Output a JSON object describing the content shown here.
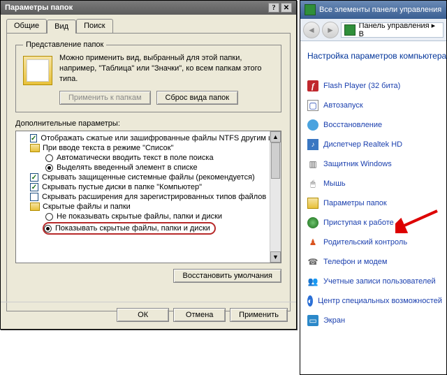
{
  "dialog": {
    "title": "Параметры папок",
    "tabs": {
      "general": "Общие",
      "view": "Вид",
      "search": "Поиск"
    },
    "group": {
      "legend": "Представление папок",
      "desc": "Можно применить вид, выбранный для этой папки, например, \"Таблица\" или \"Значки\", ко всем папкам этого типа.",
      "apply_btn": "Применить к папкам",
      "reset_btn": "Сброс вида папок"
    },
    "advanced_label": "Дополнительные параметры:",
    "tree": [
      {
        "type": "check",
        "checked": true,
        "indent": 1,
        "label": "Отображать сжатые или зашифрованные файлы NTFS другим цветом"
      },
      {
        "type": "folder",
        "indent": 1,
        "label": "При вводе текста в режиме \"Список\""
      },
      {
        "type": "radio",
        "checked": false,
        "indent": 2,
        "label": "Автоматически вводить текст в поле поиска"
      },
      {
        "type": "radio",
        "checked": true,
        "indent": 2,
        "label": "Выделять введенный элемент в списке"
      },
      {
        "type": "check",
        "checked": true,
        "indent": 1,
        "label": "Скрывать защищенные системные файлы (рекомендуется)"
      },
      {
        "type": "check",
        "checked": true,
        "indent": 1,
        "label": "Скрывать пустые диски в папке \"Компьютер\""
      },
      {
        "type": "check",
        "checked": false,
        "indent": 1,
        "label": "Скрывать расширения для зарегистрированных типов файлов"
      },
      {
        "type": "folder",
        "indent": 1,
        "label": "Скрытые файлы и папки"
      },
      {
        "type": "radio",
        "checked": false,
        "indent": 2,
        "label": "Не показывать скрытые файлы, папки и диски"
      },
      {
        "type": "radio",
        "checked": true,
        "indent": 2,
        "label": "Показывать скрытые файлы, папки и диски",
        "highlight": true
      }
    ],
    "restore_btn": "Восстановить умолчания",
    "buttons": {
      "ok": "ОК",
      "cancel": "Отмена",
      "apply": "Применить"
    }
  },
  "cp": {
    "title": "Все элементы панели управления",
    "breadcrumb": "Панель управления ▸ В",
    "heading": "Настройка параметров компьютера",
    "items": [
      {
        "icon": "flash",
        "label": "Flash Player (32 бита)"
      },
      {
        "icon": "auto",
        "label": "Автозапуск"
      },
      {
        "icon": "rec",
        "label": "Восстановление"
      },
      {
        "icon": "realtek",
        "label": "Диспетчер Realtek HD"
      },
      {
        "icon": "def",
        "label": "Защитник Windows"
      },
      {
        "icon": "mouse",
        "label": "Мышь"
      },
      {
        "icon": "folder2",
        "label": "Параметры папок"
      },
      {
        "icon": "start",
        "label": "Приступая к работе"
      },
      {
        "icon": "parent",
        "label": "Родительский контроль"
      },
      {
        "icon": "phone",
        "label": "Телефон и модем"
      },
      {
        "icon": "users",
        "label": "Учетные записи пользователей"
      },
      {
        "icon": "access",
        "label": "Центр специальных возможностей"
      },
      {
        "icon": "screen",
        "label": "Экран"
      }
    ]
  }
}
